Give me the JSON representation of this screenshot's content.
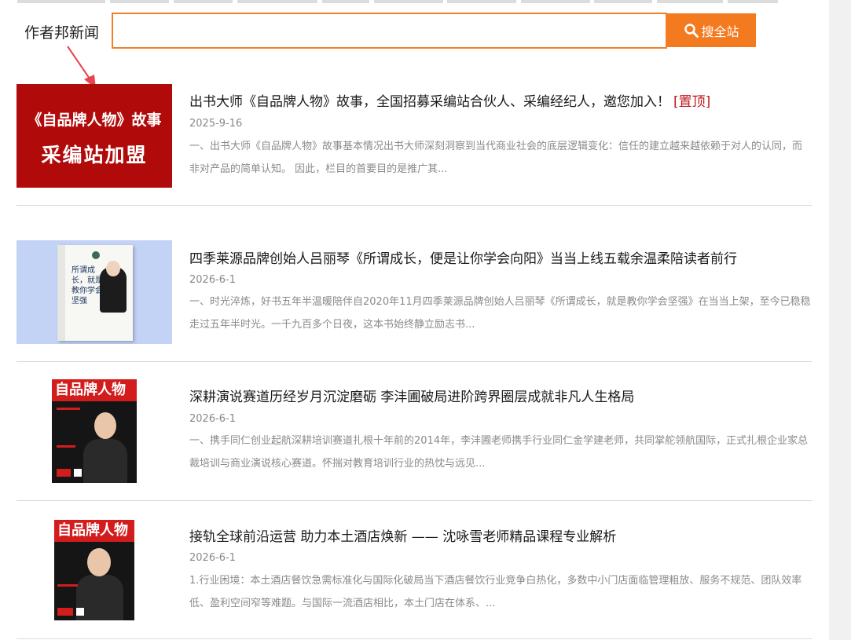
{
  "search": {
    "label": "作者邦新闻",
    "placeholder": "",
    "value": "",
    "button_label": "搜全站"
  },
  "news": [
    {
      "title": "出书大师《自品牌人物》故事，全国招募采编站合伙人、采编经纪人，邀您加入！",
      "pin": "[置顶]",
      "date": "2025-9-16",
      "summary": "一、出书大师《自品牌人物》故事基本情况出书大师深刻洞察到当代商业社会的底层逻辑变化：信任的建立越来越依赖于对人的认同，而非对产品的简单认知。 因此，栏目的首要目的是推广其...",
      "thumb_line1": "《自品牌人物》故事",
      "thumb_line2": "采编站加盟"
    },
    {
      "title": "四季莱源品牌创始人吕丽琴《所谓成长，便是让你学会向阳》当当上线五载余温柔陪读者前行",
      "date": "2026-6-1",
      "summary": "一、时光淬炼，好书五年半温暖陪伴自2020年11月四季莱源品牌创始人吕丽琴《所谓成长，就是教你学会坚强》在当当上架，至今已稳稳走过五年半时光。一千九百多个日夜，这本书始终静立励志书...",
      "book_title": "所谓成长，就是教你学会坚强"
    },
    {
      "title": "深耕演说赛道历经岁月沉淀磨砺 李沣圃破局进阶跨界圈层成就非凡人生格局",
      "date": "2026-6-1",
      "summary": "一、携手同仁创业起航深耕培训赛道扎根十年前的2014年，李沣圃老师携手行业同仁金学建老师，共同掌舵领航国际，正式扎根企业家总裁培训与商业演说核心赛道。怀揣对教育培训行业的热忱与远见...",
      "mag_title": "自品牌人物"
    },
    {
      "title": "接轨全球前沿运营 助力本土酒店焕新 —— 沈咏雪老师精品课程专业解析",
      "date": "2026-6-1",
      "summary": "1.行业困境：本土酒店餐饮急需标准化与国际化破局当下酒店餐饮行业竞争白热化，多数中小门店面临管理粗放、服务不规范、团队效率低、盈利空间窄等难题。与国际一流酒店相比，本土门店在体系、...",
      "mag_title": "自品牌人物"
    }
  ],
  "colors": {
    "accent": "#f47a1f",
    "pin": "#c0141e",
    "promo_bg": "#b10a0a"
  }
}
